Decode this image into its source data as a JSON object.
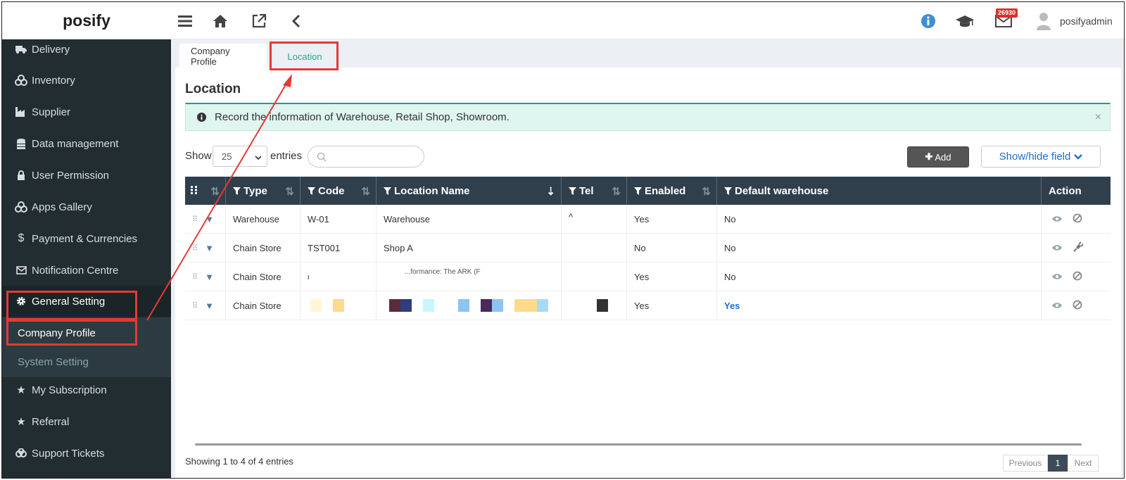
{
  "app": {
    "logo": "posify"
  },
  "header": {
    "mail_badge": "26930",
    "user_name": "posifyadmin",
    "icons": [
      "menu-icon",
      "home-icon",
      "external-link-icon",
      "back-icon",
      "info-icon",
      "graduation-cap-icon",
      "mail-icon",
      "user-avatar-icon"
    ]
  },
  "sidebar": {
    "items": [
      {
        "label": "Delivery",
        "icon": "truck-icon"
      },
      {
        "label": "Inventory",
        "icon": "cubes-icon"
      },
      {
        "label": "Supplier",
        "icon": "industry-icon"
      },
      {
        "label": "Data management",
        "icon": "database-icon"
      },
      {
        "label": "User Permission",
        "icon": "lock-icon"
      },
      {
        "label": "Apps Gallery",
        "icon": "cubes-icon"
      },
      {
        "label": "Payment & Currencies",
        "icon": "dollar-icon"
      },
      {
        "label": "Notification Centre",
        "icon": "envelope-icon"
      },
      {
        "label": "General Setting",
        "icon": "gear-icon"
      },
      {
        "label": "My Subscription",
        "icon": "star-icon"
      },
      {
        "label": "Referral",
        "icon": "star-icon"
      },
      {
        "label": "Support Tickets",
        "icon": "support-icon"
      }
    ],
    "submenu": [
      {
        "label": "Company Profile"
      },
      {
        "label": "System Setting"
      }
    ]
  },
  "tabs": [
    {
      "label": "Company Profile"
    },
    {
      "label": "Location"
    }
  ],
  "page": {
    "title": "Location",
    "alert": "Record the information of Warehouse, Retail Shop, Showroom.",
    "alert_close": "×",
    "show_label": "Show",
    "page_size": "25",
    "entries_label": "entries",
    "add_button": "Add",
    "show_hide_button": "Show/hide field",
    "info": "Showing 1 to 4 of 4 entries",
    "pager": {
      "prev": "Previous",
      "current": "1",
      "next": "Next"
    }
  },
  "table": {
    "columns": [
      "Type",
      "Code",
      "Location Name",
      "Tel",
      "Enabled",
      "Default warehouse",
      "Action"
    ],
    "rows": [
      {
        "type": "Warehouse",
        "code": "W-01",
        "name": "Warehouse",
        "tel": "^",
        "enabled": "Yes",
        "default": "No"
      },
      {
        "type": "Chain Store",
        "code": "TST001",
        "name": "Shop A",
        "tel": "",
        "enabled": "No",
        "default": "No"
      },
      {
        "type": "Chain Store",
        "code": "ι",
        "name": "...formance: The ARK (F",
        "tel": "",
        "enabled": "Yes",
        "default": "No"
      },
      {
        "type": "Chain Store",
        "code": "",
        "name": "",
        "tel": "",
        "enabled": "Yes",
        "default": "Yes"
      }
    ]
  },
  "colors": {
    "sidebar_bg": "#222d32",
    "header_bg": "#2f3f4c",
    "accent_green": "#1f9e89",
    "link_blue": "#1a6fd1",
    "annotation_red": "#e53935"
  }
}
